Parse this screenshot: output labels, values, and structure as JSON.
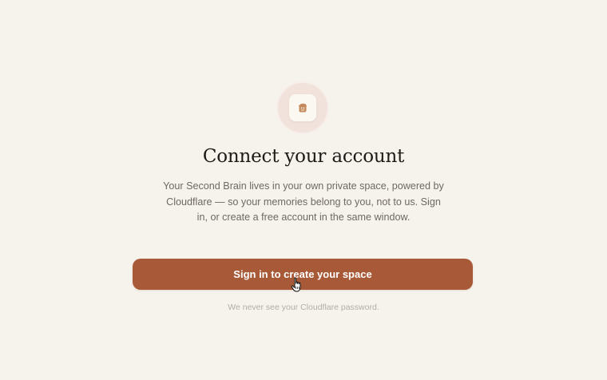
{
  "colors": {
    "background": "#f6f3ec",
    "accent": "#a85a38",
    "logo": "#c58a5b",
    "ring": "#f1e2dc"
  },
  "logo": {
    "icon": "brain-badge-icon"
  },
  "main": {
    "title": "Connect your account",
    "description": "Your Second Brain lives in your own private space, powered by Cloudflare — so your memories belong to you, not to us. Sign in, or create a free account in the same window.",
    "cta_label": "Sign in to create your space",
    "footnote": "We never see your Cloudflare password."
  },
  "cursor": {
    "icon": "hand-pointer-icon"
  }
}
